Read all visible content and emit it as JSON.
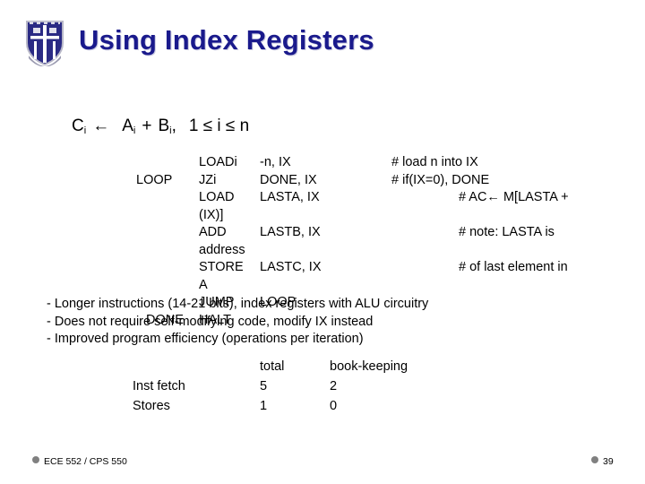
{
  "header": {
    "title": "Using Index Registers",
    "logo_name": "duke-university-shield",
    "title_color": "#1a1a8c"
  },
  "formula": {
    "c": "C",
    "sub_i1": "i",
    "arrow": "←",
    "a": "A",
    "sub_i2": "i",
    "plus": "+",
    "b": "B",
    "sub_i3": "i",
    "comma": ",",
    "range": "1 ≤ i ≤ n",
    "full_text": "Ci ← Ai + Bi,  1 ≤ i ≤ n"
  },
  "code": {
    "rows": [
      {
        "label": "",
        "op": "LOADi",
        "arg": "-n, IX",
        "comment": "# load n into IX",
        "comment_indent": false
      },
      {
        "label": "LOOP",
        "op": "JZi",
        "arg": "DONE, IX",
        "comment": "# if(IX=0), DONE",
        "comment_indent": false
      },
      {
        "label": "",
        "op": "LOAD",
        "arg": "LASTA, IX",
        "comment": "# AC← M[LASTA +",
        "comment_indent": true
      },
      {
        "label": "",
        "op": "(IX)]",
        "arg": "",
        "comment": "",
        "comment_indent": true
      },
      {
        "label": "",
        "op": "ADD",
        "arg": "LASTB, IX",
        "comment": "# note: LASTA is",
        "comment_indent": true
      },
      {
        "label": "",
        "op": "address",
        "arg": "",
        "comment": "",
        "comment_indent": true
      },
      {
        "label": "",
        "op": "STORE",
        "arg": "LASTC, IX",
        "comment": "# of last element in",
        "comment_indent": true
      },
      {
        "label": "",
        "op": "A",
        "arg": "",
        "comment": "",
        "comment_indent": true
      }
    ],
    "overlap_rows": [
      {
        "label": "",
        "op": "JUMP",
        "arg": "LOOP"
      },
      {
        "label": "DONE",
        "op": "HALT",
        "arg": ""
      }
    ]
  },
  "bullets": [
    "- Longer instructions (14-21 bits), index registers with ALU circuitry",
    "- Does not require self-modifying code, modify IX instead",
    "- Improved program efficiency (operations per iteration)"
  ],
  "stats": {
    "headers": {
      "name": "",
      "total": "total",
      "book": "book-keeping"
    },
    "rows": [
      {
        "name": "Inst fetch",
        "total": "5",
        "book": "2"
      },
      {
        "name": "Stores",
        "total": "1",
        "book": "0"
      }
    ]
  },
  "footer": {
    "course": "ECE 552 / CPS 550",
    "page": "39",
    "bullet_color": "#808080"
  }
}
